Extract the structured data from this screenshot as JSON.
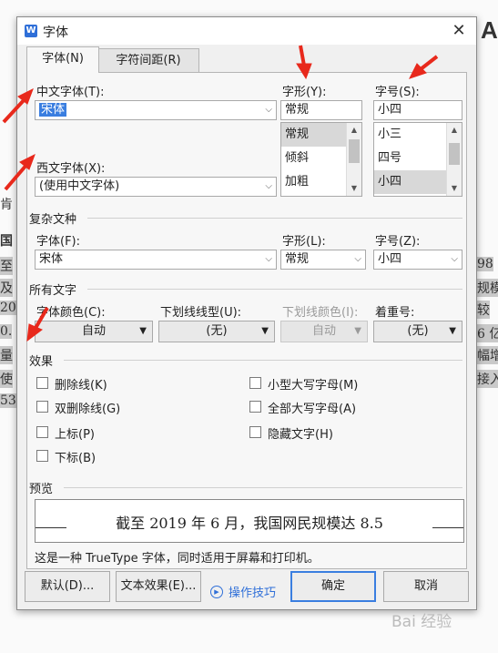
{
  "background": {
    "lines": [
      "至",
      "及",
      "20",
      "0.",
      "量",
      "使",
      "53"
    ],
    "right_lines": [
      "98",
      "规模",
      "较",
      "6 亿",
      "幅增",
      "接入"
    ],
    "top_letter": "A",
    "side_chars": [
      "肯",
      "国 国"
    ]
  },
  "dialog": {
    "title": "字体",
    "tabs": [
      "字体(N)",
      "字符间距(R)"
    ],
    "chinese_font": {
      "label": "中文字体(T):",
      "value": "宋体"
    },
    "western_font": {
      "label": "西文字体(X):",
      "value": "(使用中文字体)"
    },
    "style": {
      "label": "字形(Y):",
      "value": "常规",
      "options": [
        "常规",
        "倾斜",
        "加粗"
      ]
    },
    "size": {
      "label": "字号(S):",
      "value": "小四",
      "options": [
        "小三",
        "四号",
        "小四"
      ]
    },
    "complex": {
      "section": "复杂文种",
      "font_label": "字体(F):",
      "font_value": "宋体",
      "style_label": "字形(L):",
      "style_value": "常规",
      "size_label": "字号(Z):",
      "size_value": "小四"
    },
    "all_text": {
      "section": "所有文字",
      "color_label": "字体颜色(C):",
      "color_value": "自动",
      "underline_label": "下划线线型(U):",
      "underline_value": "(无)",
      "underline_color_label": "下划线颜色(I):",
      "underline_color_value": "自动",
      "emphasis_label": "着重号:",
      "emphasis_value": "(无)"
    },
    "effects": {
      "section": "效果",
      "left": [
        "删除线(K)",
        "双删除线(G)",
        "上标(P)",
        "下标(B)"
      ],
      "right": [
        "小型大写字母(M)",
        "全部大写字母(A)",
        "隐藏文字(H)"
      ]
    },
    "preview": {
      "section": "预览",
      "text": "截至 2019 年 6 月，我国网民规模达 8.5",
      "note": "这是一种 TrueType 字体，同时适用于屏幕和打印机。"
    },
    "buttons": {
      "default": "默认(D)...",
      "text_effect": "文本效果(E)...",
      "tips": "操作技巧",
      "ok": "确定",
      "cancel": "取消"
    }
  },
  "watermark": "Bai 经验",
  "colors": {
    "accent": "#3a7ee0",
    "arrow": "#e8291c",
    "link": "#2f6fd8"
  }
}
